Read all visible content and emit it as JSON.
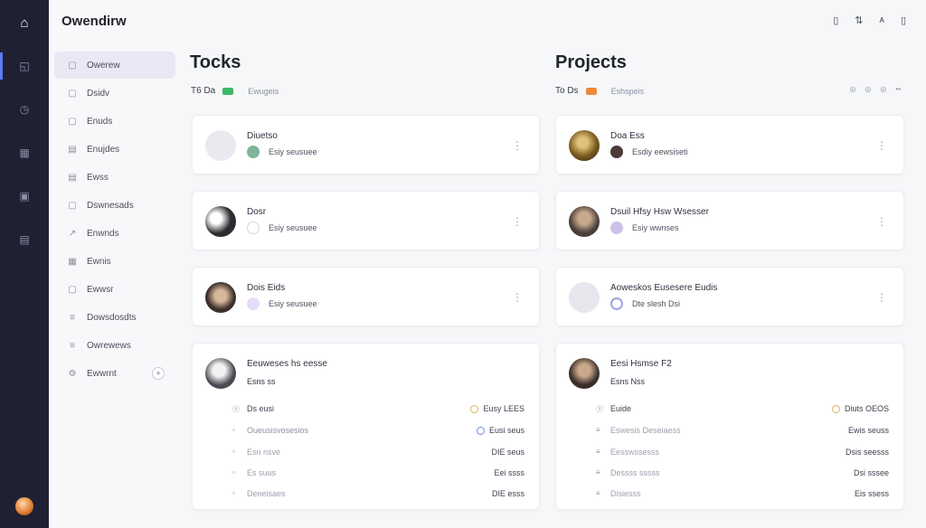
{
  "app": {
    "title": "Owendirw"
  },
  "rail": {
    "items": [
      {
        "icon": "home-icon",
        "glyph": "⌂"
      },
      {
        "icon": "dashboard-icon",
        "glyph": "◱"
      },
      {
        "icon": "clock-icon",
        "glyph": "◷"
      },
      {
        "icon": "grid-icon",
        "glyph": "▦"
      },
      {
        "icon": "calendar-icon",
        "glyph": "▣"
      },
      {
        "icon": "table-icon",
        "glyph": "▤"
      }
    ]
  },
  "sidebar": {
    "items": [
      {
        "label": "Owerew",
        "icon": "overview-icon",
        "glyph": "▢"
      },
      {
        "label": "Dsidv",
        "icon": "tasks-icon",
        "glyph": "▢"
      },
      {
        "label": "Enuds",
        "icon": "projects-icon",
        "glyph": "▢"
      },
      {
        "label": "Enujdes",
        "icon": "team-icon",
        "glyph": "▤"
      },
      {
        "label": "Ewss",
        "icon": "files-icon",
        "glyph": "▤"
      },
      {
        "label": "Dswnesads",
        "icon": "calendar-icon",
        "glyph": "▢"
      },
      {
        "label": "Enwnds",
        "icon": "activity-icon",
        "glyph": "↗"
      },
      {
        "label": "Ewnis",
        "icon": "reports-icon",
        "glyph": "▦"
      },
      {
        "label": "Ewwsr",
        "icon": "archive-icon",
        "glyph": "▢"
      },
      {
        "label": "Dowsdosdts",
        "icon": "list-icon",
        "glyph": "≡"
      },
      {
        "label": "Owrewews",
        "icon": "messages-icon",
        "glyph": "≡"
      },
      {
        "label": "Ewwrnt",
        "icon": "settings-icon",
        "glyph": "⚙"
      }
    ]
  },
  "top_icons": [
    {
      "icon": "save-icon",
      "glyph": "▯"
    },
    {
      "icon": "share-icon",
      "glyph": "⇅"
    },
    {
      "icon": "users-icon",
      "glyph": "ᴀ"
    },
    {
      "icon": "folder-icon",
      "glyph": "▯"
    }
  ],
  "tasks": {
    "title": "Tocks",
    "sub_label": "T6 Da",
    "sub_link": "Ewugeis",
    "badge_color": "#3fb86a",
    "cards": [
      {
        "title": "Diuetso",
        "meta": "Esiy seusuee",
        "avatar_color": "#e9eaef",
        "dot_color": "#7fb59a"
      },
      {
        "title": "Dosr",
        "meta": "Esiy seusuee",
        "avatar_color": "#2c2c30",
        "dot_color": "#ffffff"
      },
      {
        "title": "Dois Eids",
        "meta": "Esiy seusuee",
        "avatar_color": "#3b2e2a",
        "dot_color": "#c9b7e6"
      }
    ],
    "detail": {
      "title": "Eeuweses hs eesse",
      "subtitle": "Esns ss",
      "rows": [
        {
          "icon": "ⓢ",
          "label": "Ds eusi",
          "value": "Eusy LEES",
          "ring": "gold",
          "faded": false
        },
        {
          "icon": "▫",
          "label": "Oueusisvosesios",
          "value": "Eusi seus",
          "ring": "blue",
          "faded": false
        },
        {
          "icon": "▫",
          "label": "Esn nsve",
          "value": "DIE seus",
          "ring": "",
          "faded": true
        },
        {
          "icon": "▫",
          "label": "Es suus",
          "value": "Eei ssss",
          "ring": "",
          "faded": true
        },
        {
          "icon": "▫",
          "label": "Deneisaes",
          "value": "DIE esss",
          "ring": "",
          "faded": true
        }
      ]
    }
  },
  "projects": {
    "title": "Projects",
    "sub_label": "To Ds",
    "sub_link": "Eshspeis",
    "badge_color": "#f08a3a",
    "actions": [
      "◎",
      "◎",
      "◎",
      "••"
    ],
    "cards": [
      {
        "title": "Doa Ess",
        "meta": "Esdiy eewsiseti",
        "avatar_color": "#7a5b20",
        "dot_color": "#4b3a36"
      },
      {
        "title": "Dsuil Hfsy Hsw Wsesser",
        "meta": "Esiy wwnses",
        "avatar_color": "#4a3e38",
        "dot_color": "#cdbfe8"
      },
      {
        "title": "Aoweskos Eusesere Eudis",
        "meta": "Dte slesh Dsi",
        "avatar_color": "#e6e7ec",
        "dot_color": "#9aa7e6"
      }
    ],
    "detail": {
      "title": "Eesi Hsmse F2",
      "subtitle": "Esns Nss",
      "rows": [
        {
          "icon": "ⓢ",
          "label": "Euide",
          "value": "Diuts OEOS",
          "ring": "gold",
          "faded": false
        },
        {
          "icon": "≡",
          "label": "Eswesis Deseiaess",
          "value": "Ewis seuss",
          "ring": "",
          "faded": true
        },
        {
          "icon": "≡",
          "label": "Eesswssesss",
          "value": "Dsis seesss",
          "ring": "",
          "faded": true
        },
        {
          "icon": "≡",
          "label": "Dessss sssss",
          "value": "Dsi sssee",
          "ring": "",
          "faded": true
        },
        {
          "icon": "≡",
          "label": "Disiesss",
          "value": "Eis ssess",
          "ring": "",
          "faded": true
        }
      ]
    }
  }
}
